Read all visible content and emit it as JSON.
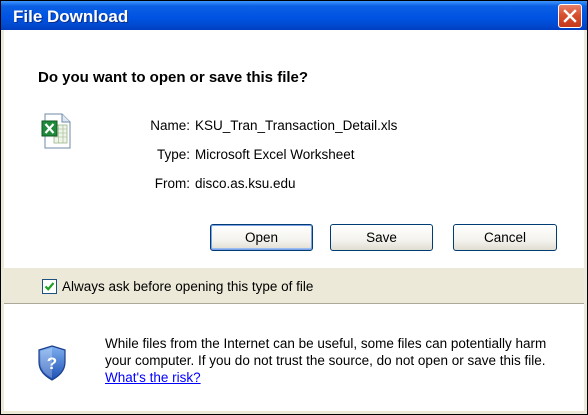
{
  "dialog": {
    "title": "File Download",
    "question": "Do you want to open or save this file?"
  },
  "file": {
    "icon": "excel-file-icon",
    "name_label": "Name:",
    "name_value": "KSU_Tran_Transaction_Detail.xls",
    "type_label": "Type:",
    "type_value": "Microsoft Excel Worksheet",
    "from_label": "From:",
    "from_value": "disco.as.ksu.edu"
  },
  "buttons": {
    "open": "Open",
    "save": "Save",
    "cancel": "Cancel"
  },
  "checkbox": {
    "label": "Always ask before opening this type of file",
    "checked": true
  },
  "warning": {
    "icon": "shield-help-icon",
    "text": "While files from the Internet can be useful, some files can potentially harm your computer. If you do not trust the source, do not open or save this file.",
    "link": "What's the risk?"
  },
  "colors": {
    "titlebar": "#0054e3",
    "close_button": "#d8502f",
    "dialog_face": "#ece9d8",
    "link": "#0000ff"
  }
}
